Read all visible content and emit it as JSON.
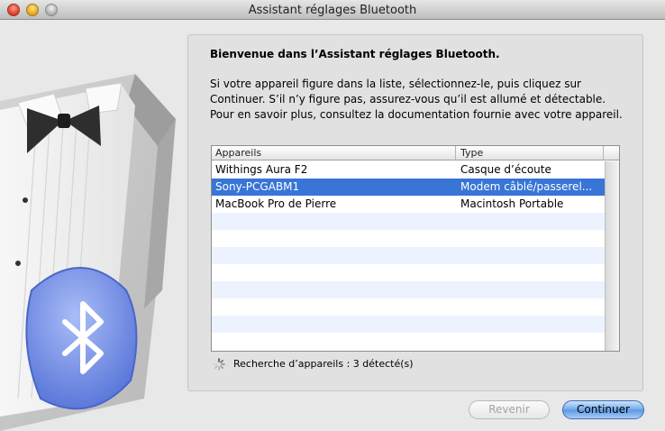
{
  "window": {
    "title": "Assistant réglages Bluetooth"
  },
  "panel": {
    "welcome": "Bienvenue dans l’Assistant réglages Bluetooth.",
    "description": "Si votre appareil figure dans la liste, sélectionnez-le, puis cliquez sur Continuer. S’il n’y figure pas, assurez-vous qu’il est allumé et détectable. Pour en savoir plus, consultez la documentation fournie avec votre appareil."
  },
  "table": {
    "headers": {
      "name": "Appareils",
      "type": "Type"
    },
    "rows": [
      {
        "name": "Withings Aura F2",
        "type": "Casque d’écoute",
        "selected": false
      },
      {
        "name": "Sony-PCGABM1",
        "type": "Modem câblé/passerel...",
        "selected": true
      },
      {
        "name": "MacBook Pro de Pierre",
        "type": "Macintosh Portable",
        "selected": false
      },
      {
        "name": "",
        "type": "",
        "selected": false
      },
      {
        "name": "",
        "type": "",
        "selected": false
      },
      {
        "name": "",
        "type": "",
        "selected": false
      },
      {
        "name": "",
        "type": "",
        "selected": false
      },
      {
        "name": "",
        "type": "",
        "selected": false
      },
      {
        "name": "",
        "type": "",
        "selected": false
      },
      {
        "name": "",
        "type": "",
        "selected": false
      },
      {
        "name": "",
        "type": "",
        "selected": false
      }
    ]
  },
  "status": {
    "text": "Recherche d’appareils : 3 détecté(s)"
  },
  "buttons": {
    "back": "Revenir",
    "continue": "Continuer"
  },
  "colors": {
    "selection": "#3875d7",
    "stripe": "#edf3fe",
    "bluetooth": "#6f8fe8"
  },
  "icons": [
    "close-icon",
    "minimize-icon",
    "zoom-icon",
    "bluetooth-icon",
    "spinner-icon"
  ]
}
